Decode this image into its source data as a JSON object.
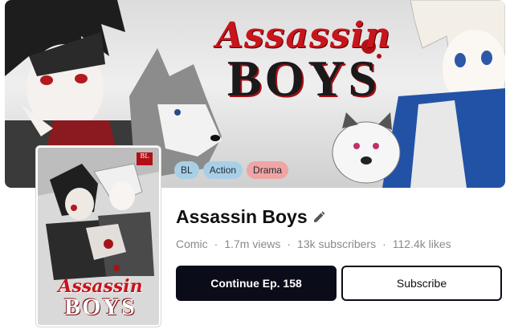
{
  "banner": {
    "title_script": "Assassin",
    "title_block": "BOYS"
  },
  "tags": [
    {
      "label": "BL",
      "color": "#a9cfe6"
    },
    {
      "label": "Action",
      "color": "#a9cfe6"
    },
    {
      "label": "Drama",
      "color": "#f0a4a4"
    }
  ],
  "cover": {
    "badge": "BL",
    "title_script": "Assassin",
    "title_block": "BOYS"
  },
  "series": {
    "title": "Assassin Boys",
    "edit_icon": "pencil-icon",
    "meta": [
      "Comic",
      "1.7m views",
      "13k subscribers",
      "112.4k likes"
    ],
    "separator": "·"
  },
  "actions": {
    "continue_label": "Continue Ep. 158",
    "subscribe_label": "Subscribe"
  },
  "colors": {
    "primary_button": "#0b0c1a",
    "accent_red": "#c8141c"
  }
}
